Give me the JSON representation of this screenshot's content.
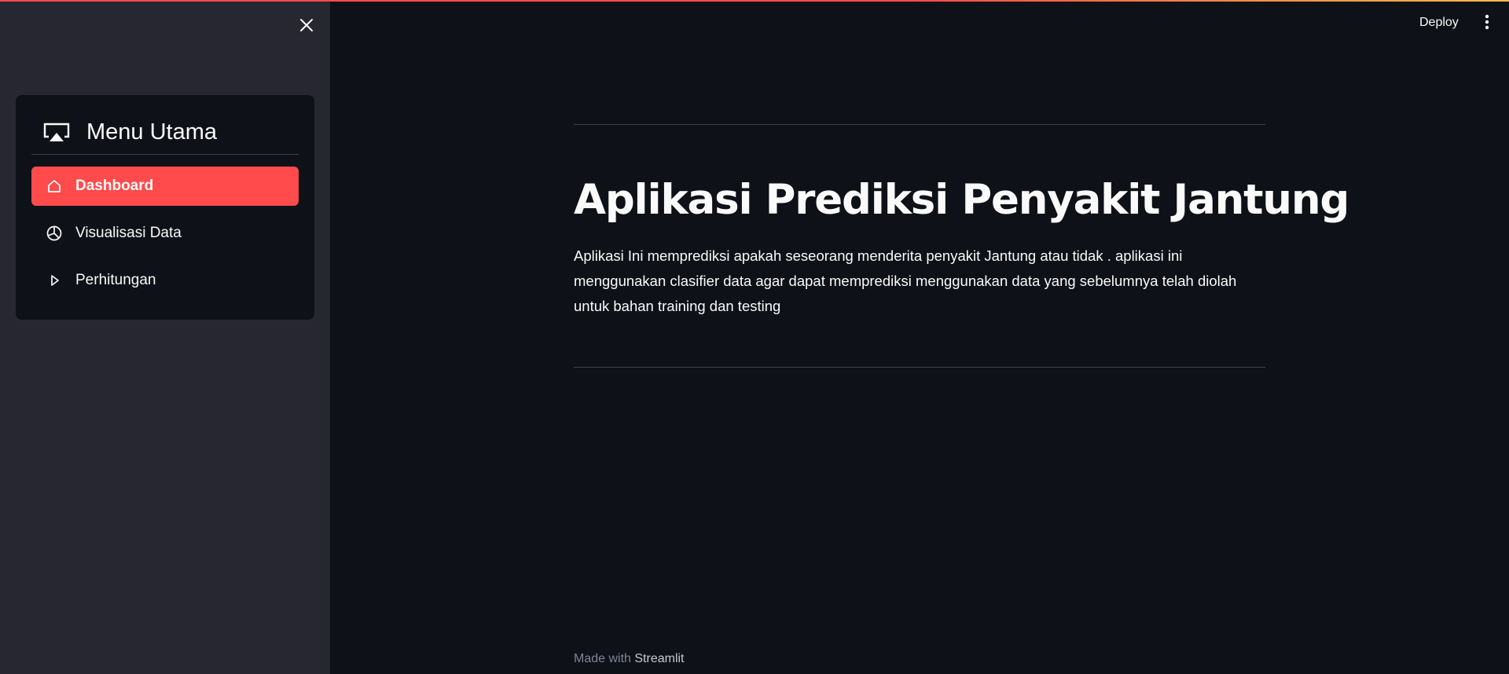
{
  "colors": {
    "background": "#0e1117",
    "sidebar": "#262730",
    "accent": "#ff4b4b",
    "text": "#fafafa",
    "muted": "#808495"
  },
  "header": {
    "deploy_label": "Deploy",
    "menu_icon": "kebab-menu-icon"
  },
  "sidebar": {
    "close_icon": "close-icon",
    "menu": {
      "title": "Menu Utama",
      "title_icon": "airplay-icon",
      "items": [
        {
          "label": "Dashboard",
          "icon": "house-icon",
          "active": true
        },
        {
          "label": "Visualisasi Data",
          "icon": "pie-chart-icon",
          "active": false
        },
        {
          "label": "Perhitungan",
          "icon": "play-icon",
          "active": false
        }
      ]
    }
  },
  "main": {
    "title": "Aplikasi Prediksi Penyakit Jantung",
    "description": "Aplikasi Ini memprediksi apakah seseorang menderita penyakit Jantung atau tidak . aplikasi ini menggunakan clasifier data agar dapat memprediksi menggunakan data yang sebelumnya telah diolah untuk bahan training dan testing"
  },
  "footer": {
    "prefix": "Made with",
    "brand": "Streamlit"
  }
}
